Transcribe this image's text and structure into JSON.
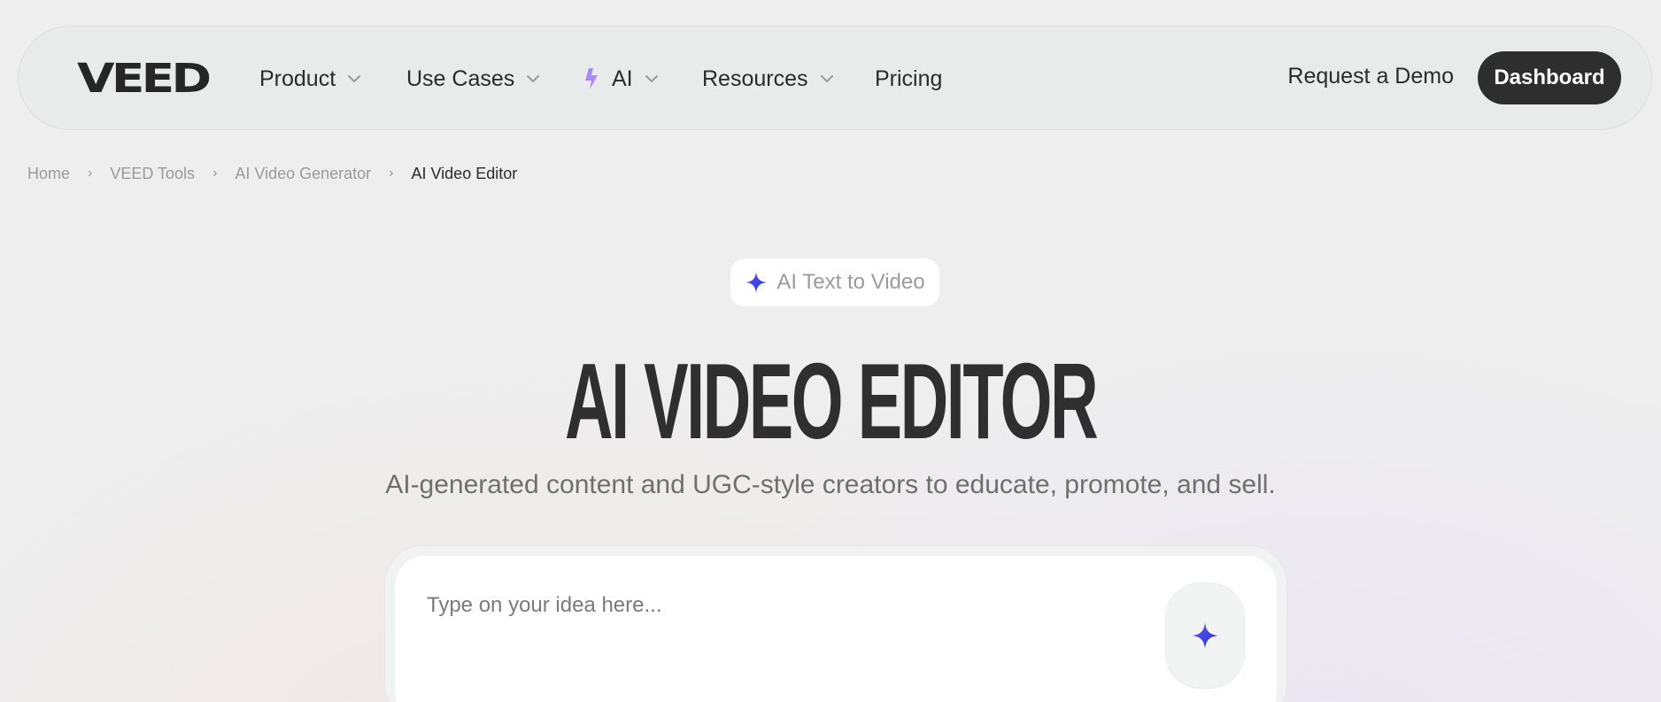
{
  "brand": {
    "logo_text": "VEED"
  },
  "nav": {
    "items": [
      {
        "label": "Product",
        "has_dropdown": true
      },
      {
        "label": "Use Cases",
        "has_dropdown": true
      },
      {
        "label": "AI",
        "has_dropdown": true,
        "icon": "bolt-icon"
      },
      {
        "label": "Resources",
        "has_dropdown": true
      },
      {
        "label": "Pricing",
        "has_dropdown": false
      }
    ],
    "request_demo": "Request a Demo",
    "dashboard": "Dashboard"
  },
  "breadcrumb": {
    "items": [
      "Home",
      "VEED Tools",
      "AI Video Generator"
    ],
    "current": "AI Video Editor"
  },
  "hero": {
    "pill_label": "AI Text to Video",
    "title": "AI VIDEO EDITOR",
    "subtitle": "AI-generated content and UGC-style creators to educate, promote, and sell."
  },
  "prompt": {
    "placeholder": "Type on your idea here..."
  },
  "colors": {
    "accent_gradient_start": "#6b5cf6",
    "accent_gradient_end": "#1c2cd6",
    "bolt": "#a78bfa",
    "dark_button": "#2e2e2e"
  }
}
